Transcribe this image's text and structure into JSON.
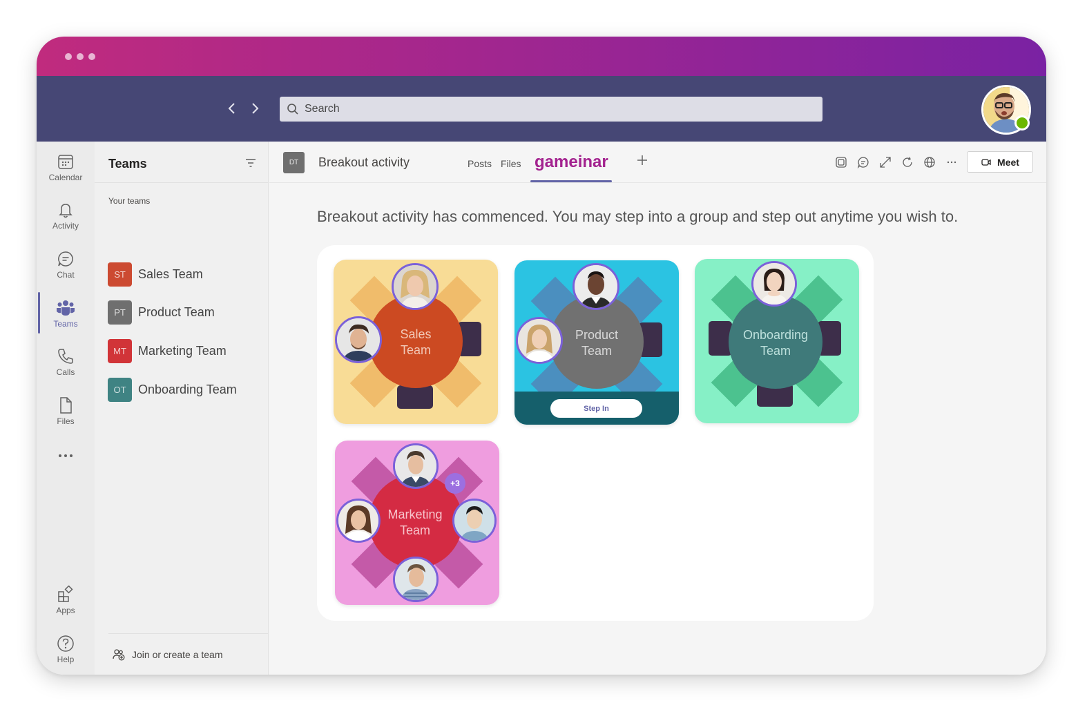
{
  "header": {
    "search_placeholder": "Search"
  },
  "rail": {
    "items": [
      {
        "label": "Calendar",
        "icon": "calendar-icon"
      },
      {
        "label": "Activity",
        "icon": "bell-icon"
      },
      {
        "label": "Chat",
        "icon": "chat-icon"
      },
      {
        "label": "Teams",
        "icon": "teams-icon"
      },
      {
        "label": "Calls",
        "icon": "phone-icon"
      },
      {
        "label": "Files",
        "icon": "file-icon"
      },
      {
        "label": "Apps",
        "icon": "apps-icon"
      },
      {
        "label": "Help",
        "icon": "help-icon"
      }
    ],
    "active": "Teams"
  },
  "teams_panel": {
    "title": "Teams",
    "section_label": "Your teams",
    "teams": [
      {
        "initials": "ST",
        "name": "Sales Team",
        "color": "#cc4a31"
      },
      {
        "initials": "PT",
        "name": "Product Team",
        "color": "#6f6f6f"
      },
      {
        "initials": "MT",
        "name": "Marketing Team",
        "color": "#d13438"
      },
      {
        "initials": "OT",
        "name": "Onboarding Team",
        "color": "#3f8383"
      }
    ],
    "join_label": "Join or create a team"
  },
  "channel": {
    "badge": "DT",
    "title": "Breakout activity",
    "tabs": [
      "Posts",
      "Files"
    ],
    "active_tab": "gameinar",
    "meet_label": "Meet"
  },
  "activity": {
    "message": "Breakout activity has commenced. You may step into a group and step out anytime you wish to.",
    "groups": [
      {
        "label_line1": "Sales",
        "label_line2": "Team",
        "bg": "#f8dc96",
        "accent": "#f0bc6b",
        "table": "#cc4a22",
        "text": "#f2c9b8"
      },
      {
        "label_line1": "Product",
        "label_line2": "Team",
        "bg": "#2bc3e2",
        "accent": "#4b8fbf",
        "table": "#717171",
        "text": "#d8d8d8",
        "action": "Step In"
      },
      {
        "label_line1": "Onboarding",
        "label_line2": "Team",
        "bg": "#86f0c6",
        "accent": "#4cc28f",
        "table": "#3f7a7a",
        "text": "#bde0dc"
      },
      {
        "label_line1": "Marketing",
        "label_line2": "Team",
        "bg": "#ef9ddf",
        "accent": "#c45aa8",
        "table": "#d42b43",
        "text": "#f7c4cc",
        "extra_count": "+3"
      }
    ]
  }
}
